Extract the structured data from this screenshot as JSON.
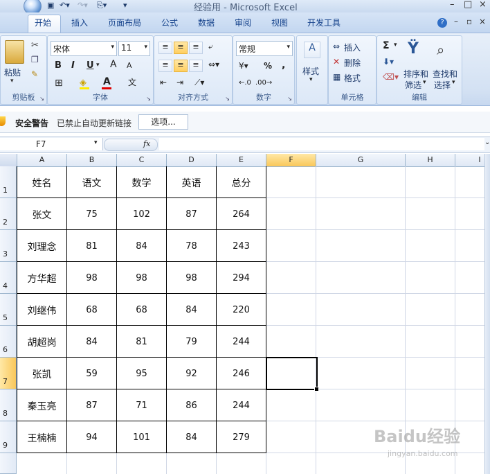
{
  "window": {
    "title": "经验用 - Microsoft Excel",
    "controls": [
      "–",
      "□",
      "×"
    ]
  },
  "ribbon_tabs": [
    "开始",
    "插入",
    "页面布局",
    "公式",
    "数据",
    "审阅",
    "视图",
    "开发工具"
  ],
  "ribbon": {
    "clipboard": {
      "paste": "粘贴",
      "label": "剪贴板"
    },
    "font": {
      "name": "宋体",
      "size": "11",
      "bold": "B",
      "italic": "I",
      "underline": "U",
      "grow": "A",
      "shrink": "A",
      "label": "字体",
      "phonetic": "文"
    },
    "alignment": {
      "label": "对齐方式"
    },
    "number": {
      "format": "常规",
      "percent": "%",
      "comma": ",",
      "label": "数字"
    },
    "styles": {
      "label": "样式"
    },
    "cells": {
      "insert": "插入",
      "delete": "删除",
      "format": "格式",
      "label": "单元格"
    },
    "editing": {
      "sigma": "Σ",
      "sort": "排序和",
      "sort2": "筛选",
      "find": "查找和",
      "find2": "选择",
      "label": "编辑"
    }
  },
  "security": {
    "title": "安全警告",
    "message": "已禁止自动更新链接",
    "options_button": "选项..."
  },
  "formula_bar": {
    "name_box": "F7",
    "fx": "fx",
    "content": ""
  },
  "columns": [
    "A",
    "B",
    "C",
    "D",
    "E",
    "F",
    "G",
    "H",
    "I"
  ],
  "active_column": "F",
  "active_row": "7",
  "rows": [
    "1",
    "2",
    "3",
    "4",
    "5",
    "6",
    "7",
    "8",
    "9"
  ],
  "table": {
    "header": [
      "姓名",
      "语文",
      "数学",
      "英语",
      "总分"
    ],
    "rows": [
      [
        "张文",
        "75",
        "102",
        "87",
        "264"
      ],
      [
        "刘理念",
        "81",
        "84",
        "78",
        "243"
      ],
      [
        "方华超",
        "98",
        "98",
        "98",
        "294"
      ],
      [
        "刘继伟",
        "68",
        "68",
        "84",
        "220"
      ],
      [
        "胡超岗",
        "84",
        "81",
        "79",
        "244"
      ],
      [
        "张凯",
        "59",
        "95",
        "92",
        "246"
      ],
      [
        "秦玉亮",
        "87",
        "71",
        "86",
        "244"
      ],
      [
        "王楠楠",
        "94",
        "101",
        "84",
        "279"
      ]
    ]
  },
  "watermark": {
    "text": "Baidu经验",
    "url": "jingyan.baidu.com"
  }
}
